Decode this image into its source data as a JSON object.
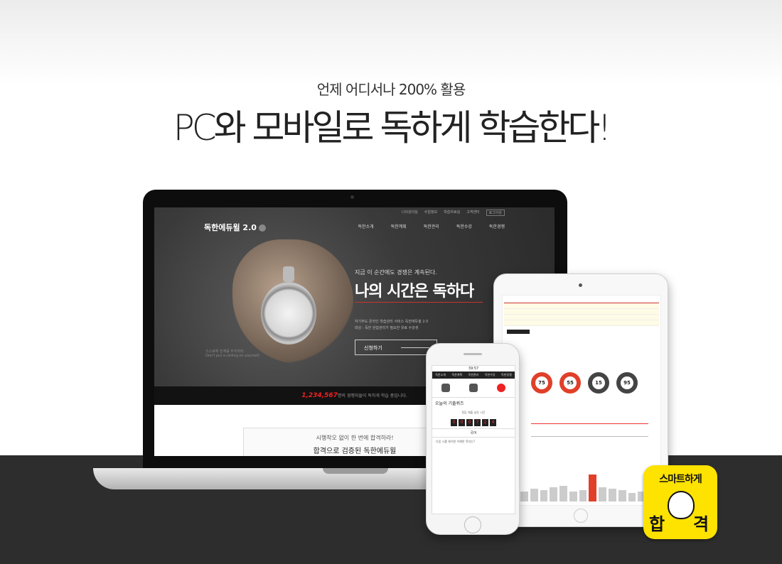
{
  "header": {
    "subtitle": "언제 어디서나 200% 활용",
    "title": "PC와 모바일로 독하게 학습한다!"
  },
  "laptop": {
    "brand": "독한에듀윌 2.0",
    "top_links": [
      "나의강의실",
      "수험정보",
      "학습자료실",
      "고객센터",
      "로그아웃"
    ],
    "nav": [
      "독한소개",
      "독한계획",
      "독한관리",
      "독한수강",
      "독한경쟁"
    ],
    "tagline_small": "지금 이 순간에도 경쟁은 계속된다.",
    "tagline_big": "나의 시간은 독하다",
    "desc_line1": "자기주도 온라인 학습관리 서비스 독한에듀윌 2.0",
    "desc_line2": "대상 : 독한 완습관리가 필요한 유료 수강생",
    "apply_label": "신청하기",
    "aside_line1": "스스로에 한계를 두지마라.",
    "aside_line2": "Don't put a ceiling on yourself.",
    "stat_number": "1,234,567",
    "stat_text": "명의 경쟁자들이 독하게 학습 중입니다.",
    "card_line1": "시행착오 없이 한 번에 합격하라!",
    "card_line2": "합격으로 검증된 독한에듀윌"
  },
  "tablet": {
    "gauges": [
      {
        "value": "75",
        "accent": true
      },
      {
        "value": "55",
        "accent": true
      },
      {
        "value": "15",
        "accent": false
      },
      {
        "value": "95",
        "accent": false
      }
    ],
    "bar_heights": [
      0.35,
      0.45,
      0.4,
      0.5,
      0.55,
      0.35,
      0.4,
      0.95,
      0.5,
      0.45,
      0.4,
      0.3,
      0.35,
      0.25
    ]
  },
  "phone": {
    "status": "39:57",
    "nav": [
      "독한소개",
      "독한계획",
      "독한관리",
      "독한수강",
      "독한경쟁"
    ],
    "quiz_title": "오늘의 기출퀴즈",
    "timer_label": "정답 제출 남은 시간",
    "timer_digits": [
      "0",
      "0",
      "0",
      "7",
      "2",
      "4"
    ],
    "subject": "국어",
    "question": "다음 시를 해석한 이해한 학자는?"
  },
  "badge": {
    "line1": "스마트하게",
    "left_char": "합",
    "right_char": "격"
  },
  "colors": {
    "accent": "#e0402a",
    "band": "#2d2d2d",
    "badge": "#fee200"
  }
}
